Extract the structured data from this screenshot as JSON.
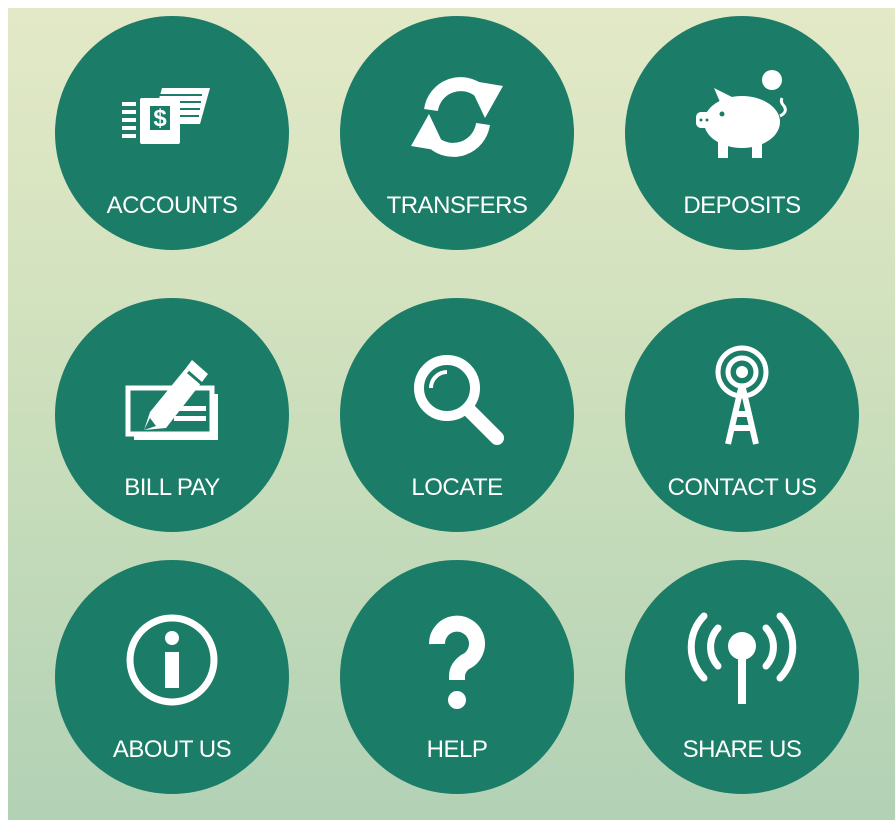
{
  "menu": {
    "items": [
      {
        "label": "ACCOUNTS",
        "icon": "cash-stack-icon"
      },
      {
        "label": "TRANSFERS",
        "icon": "refresh-arrows-icon"
      },
      {
        "label": "DEPOSITS",
        "icon": "piggy-bank-icon"
      },
      {
        "label": "BILL PAY",
        "icon": "check-pencil-icon"
      },
      {
        "label": "LOCATE",
        "icon": "magnifier-icon"
      },
      {
        "label": "CONTACT US",
        "icon": "radio-tower-icon"
      },
      {
        "label": "ABOUT US",
        "icon": "info-icon"
      },
      {
        "label": "HELP",
        "icon": "question-mark-icon"
      },
      {
        "label": "SHARE US",
        "icon": "broadcast-icon"
      }
    ]
  },
  "colors": {
    "tile": "#1b7c67",
    "label": "#ffffff",
    "background_top": "#e3e9c7",
    "background_bottom": "#b2d1b5"
  }
}
